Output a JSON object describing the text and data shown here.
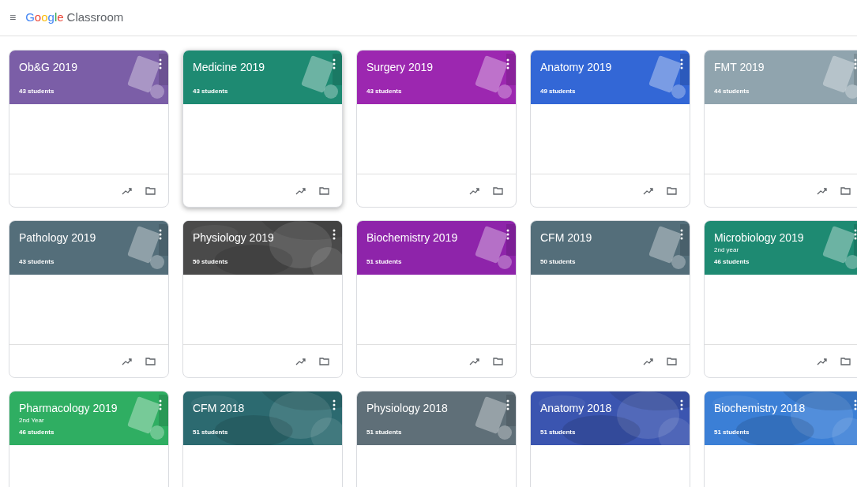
{
  "app_bar": {
    "menu": "≡",
    "brand": [
      {
        "text": "G",
        "color": "#4285f4"
      },
      {
        "text": "o",
        "color": "#ea4335"
      },
      {
        "text": "o",
        "color": "#fbbc05"
      },
      {
        "text": "g",
        "color": "#4285f4"
      },
      {
        "text": "l",
        "color": "#34a853"
      },
      {
        "text": "e",
        "color": "#ea4335"
      }
    ],
    "product": "Classroom"
  },
  "classes": [
    {
      "title": "Ob&G 2019",
      "students": "43 students",
      "color": "#7b5ea7",
      "kind": "illustration",
      "hovered": false
    },
    {
      "title": "Medicine 2019",
      "students": "43 students",
      "color": "#1e8a72",
      "kind": "illustration",
      "hovered": true
    },
    {
      "title": "Surgery 2019",
      "students": "43 students",
      "color": "#9c27b0",
      "kind": "illustration",
      "hovered": false
    },
    {
      "title": "Anatomy 2019",
      "students": "49 students",
      "color": "#3367d6",
      "kind": "illustration",
      "hovered": false
    },
    {
      "title": "FMT 2019",
      "students": "44 students",
      "color": "#90a4ae",
      "kind": "illustration",
      "hovered": false
    },
    {
      "title": "Pathology 2019",
      "students": "43 students",
      "color": "#546e7a",
      "kind": "illustration",
      "hovered": false
    },
    {
      "title": "Physiology 2019",
      "students": "50 students",
      "color": "#4a4a4a",
      "kind": "picture",
      "hovered": false
    },
    {
      "title": "Biochemistry 2019",
      "students": "51 students",
      "color": "#8e24aa",
      "kind": "illustration",
      "hovered": false
    },
    {
      "title": "CFM 2019",
      "students": "50 students",
      "color": "#546e7a",
      "kind": "illustration",
      "hovered": false
    },
    {
      "title": "Microbiology 2019",
      "subtitle": "2nd year",
      "students": "46 students",
      "color": "#1e8a72",
      "kind": "illustration",
      "hovered": false
    },
    {
      "title": "Pharmacology 2019",
      "subtitle": "2nd Year",
      "students": "46 students",
      "color": "#2fae62",
      "kind": "illustration",
      "hovered": false
    },
    {
      "title": "CFM 2018",
      "students": "51 students",
      "color": "#2c6a70",
      "kind": "picture",
      "hovered": false
    },
    {
      "title": "Physiology 2018",
      "students": "51 students",
      "color": "#5f6f78",
      "kind": "illustration",
      "hovered": false
    },
    {
      "title": "Anatomy 2018",
      "students": "51 students",
      "color": "#3b55b0",
      "kind": "picture",
      "hovered": false
    },
    {
      "title": "Biochemistry 2018",
      "students": "51 students",
      "color": "#3b7fd6",
      "kind": "picture",
      "hovered": false
    }
  ]
}
